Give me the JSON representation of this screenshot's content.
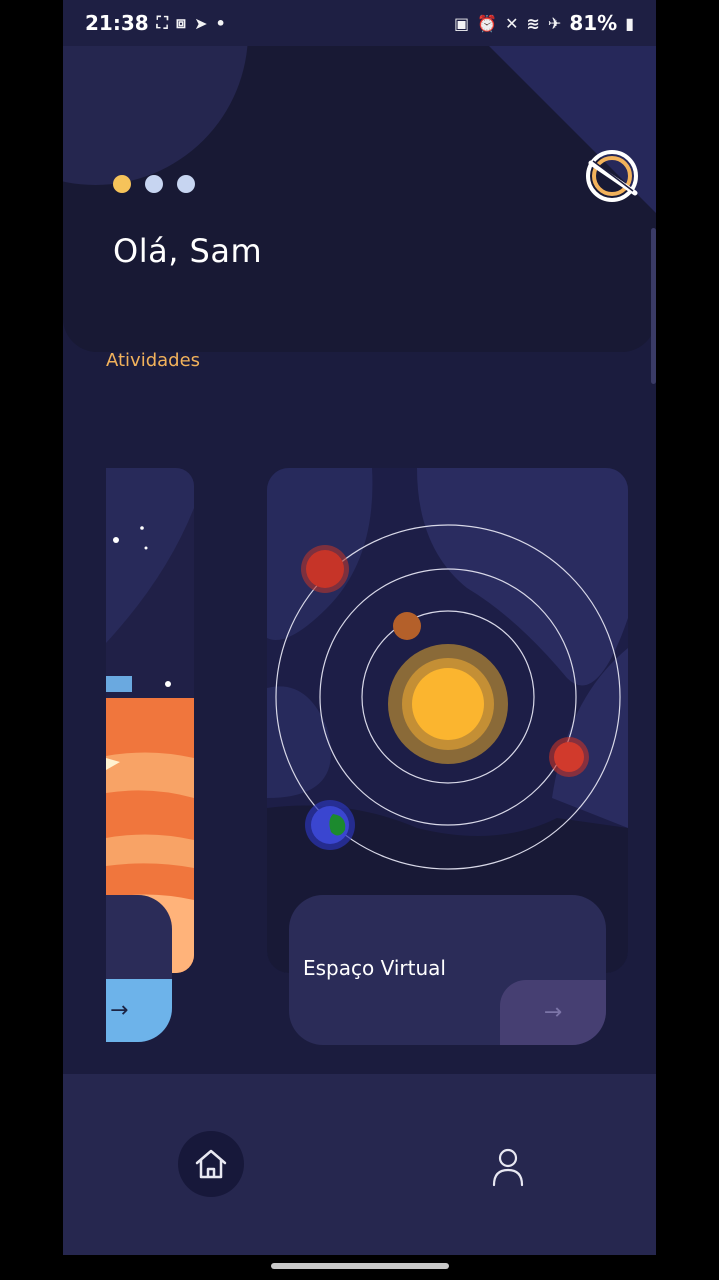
{
  "status_bar": {
    "time": "21:38",
    "battery": "81%",
    "left_icons": [
      "screenshot-icon",
      "screen-record-icon",
      "telegram-icon",
      "notification-dot-icon"
    ],
    "right_icons": [
      "battery-saver-icon",
      "alarm-icon",
      "mute-icon",
      "wifi-icon",
      "airplane-icon",
      "battery-icon"
    ]
  },
  "header": {
    "greeting": "Olá, Sam",
    "pager_dots": [
      {
        "color": "#f6c35a"
      },
      {
        "color": "#c7d5f1"
      },
      {
        "color": "#c7d5f1"
      }
    ],
    "logo_icon": "planet-ring-icon"
  },
  "section": {
    "title": "Atividades"
  },
  "cards": [
    {
      "title": "",
      "accent": "#6db3ea",
      "action_icon": "arrow-right-icon"
    },
    {
      "title": "Espaço Virtual",
      "accent": "#463f72",
      "action_icon": "arrow-right-icon"
    }
  ],
  "bottom_nav": {
    "items": [
      {
        "icon": "home-icon",
        "active": true
      },
      {
        "icon": "profile-icon",
        "active": false
      }
    ]
  },
  "colors": {
    "background": "#1b1c3e",
    "accent_orange": "#f2b25b",
    "sun": "#fbb52f"
  }
}
